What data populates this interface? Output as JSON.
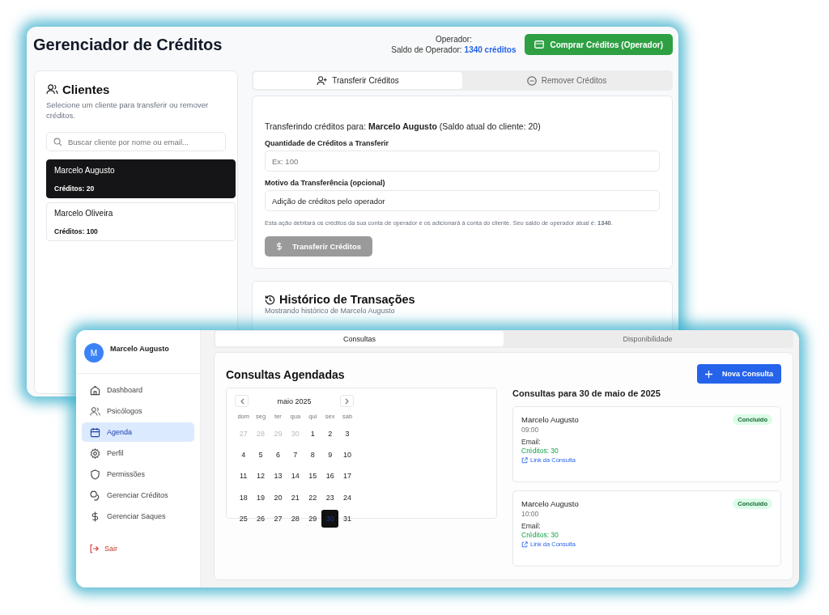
{
  "credit_window": {
    "title": "Gerenciador de Créditos",
    "operator_label": "Operador:",
    "balance_label": "Saldo de Operador:",
    "balance_value": "1340 créditos",
    "buy_button": "Comprar Créditos (Operador)",
    "clients": {
      "title": "Clientes",
      "subtitle": "Selecione um cliente para transferir ou remover créditos.",
      "search_placeholder": "Buscar cliente por nome ou email...",
      "items": [
        {
          "name": "Marcelo Augusto",
          "credits": "Créditos: 20",
          "selected": true
        },
        {
          "name": "Marcelo Oliveira",
          "credits": "Créditos: 100",
          "selected": false
        }
      ]
    },
    "tabs": [
      {
        "label": "Transferir Créditos",
        "selected": true
      },
      {
        "label": "Remover Créditos",
        "selected": false
      }
    ],
    "transfer": {
      "heading": "Transferindo créditos para: **Marcelo Augusto** (Saldo atual do cliente: 20)",
      "fields": [
        {
          "label": "Quantidade de Créditos a Transferir",
          "placeholder": "Ex: 100"
        },
        {
          "label": "Motivo da Transferência (opcional)",
          "value": "Adição de créditos pelo operador"
        }
      ],
      "note": "Esta ação debitará os créditos da sua conta de operador e os adicionará à conta do cliente. Seu saldo de operador atual é: **1340**.",
      "submit": {
        "label": "Transferir Créditos",
        "disabled": true
      }
    },
    "history": {
      "title": "Histórico de Transações",
      "subtitle": "Mostrando histórico de Marcelo Augusto"
    }
  },
  "agenda_window": {
    "user": {
      "initial": "M",
      "name": "Marcelo Augusto"
    },
    "nav": [
      {
        "label": "Dashboard",
        "selected": false
      },
      {
        "label": "Psicólogos",
        "selected": false
      },
      {
        "label": "Agenda",
        "selected": true
      },
      {
        "label": "Perfil",
        "selected": false
      },
      {
        "label": "Permissões",
        "selected": false
      },
      {
        "label": "Gerenciar Créditos",
        "selected": false
      },
      {
        "label": "Gerenciar Saques",
        "selected": false
      }
    ],
    "logout": "Sair",
    "tabs": [
      {
        "label": "Consultas",
        "selected": true
      },
      {
        "label": "Disponibilidade",
        "selected": false
      }
    ],
    "title": "Consultas Agendadas",
    "calendar": {
      "month": "maio 2025",
      "weekdays": [
        "dom",
        "seg",
        "ter",
        "qua",
        "qui",
        "sex",
        "sab"
      ],
      "weeks": [
        [
          {
            "day": "27",
            "muted": true,
            "selected": false
          },
          {
            "day": "28",
            "muted": true,
            "selected": false
          },
          {
            "day": "29",
            "muted": true,
            "selected": false
          },
          {
            "day": "30",
            "muted": true,
            "selected": false
          },
          {
            "day": "1",
            "muted": false,
            "selected": false
          },
          {
            "day": "2",
            "muted": false,
            "selected": false
          },
          {
            "day": "3",
            "muted": false,
            "selected": false
          }
        ],
        [
          {
            "day": "4",
            "muted": false,
            "selected": false
          },
          {
            "day": "5",
            "muted": false,
            "selected": false
          },
          {
            "day": "6",
            "muted": false,
            "selected": false
          },
          {
            "day": "7",
            "muted": false,
            "selected": false
          },
          {
            "day": "8",
            "muted": false,
            "selected": false
          },
          {
            "day": "9",
            "muted": false,
            "selected": false
          },
          {
            "day": "10",
            "muted": false,
            "selected": false
          }
        ],
        [
          {
            "day": "11",
            "muted": false,
            "selected": false
          },
          {
            "day": "12",
            "muted": false,
            "selected": false
          },
          {
            "day": "13",
            "muted": false,
            "selected": false
          },
          {
            "day": "14",
            "muted": false,
            "selected": false
          },
          {
            "day": "15",
            "muted": false,
            "selected": false
          },
          {
            "day": "16",
            "muted": false,
            "selected": false
          },
          {
            "day": "17",
            "muted": false,
            "selected": false
          }
        ],
        [
          {
            "day": "18",
            "muted": false,
            "selected": false
          },
          {
            "day": "19",
            "muted": false,
            "selected": false
          },
          {
            "day": "20",
            "muted": false,
            "selected": false
          },
          {
            "day": "21",
            "muted": false,
            "selected": false
          },
          {
            "day": "22",
            "muted": false,
            "selected": false
          },
          {
            "day": "23",
            "muted": false,
            "selected": false
          },
          {
            "day": "24",
            "muted": false,
            "selected": false
          }
        ],
        [
          {
            "day": "25",
            "muted": false,
            "selected": false
          },
          {
            "day": "26",
            "muted": false,
            "selected": false
          },
          {
            "day": "27",
            "muted": false,
            "selected": false
          },
          {
            "day": "28",
            "muted": false,
            "selected": false
          },
          {
            "day": "29",
            "muted": false,
            "selected": false
          },
          {
            "day": "30",
            "muted": false,
            "selected": true
          },
          {
            "day": "31",
            "muted": false,
            "selected": false
          }
        ]
      ]
    },
    "new_button": "Nova Consulta",
    "day_title": "Consultas para 30 de maio de 2025",
    "appointments": [
      {
        "name": "Marcelo Augusto",
        "time": "09:00",
        "email_label": "Email:",
        "credits": "Créditos: 30",
        "link": "Link da Consulta",
        "status": "Concluído"
      },
      {
        "name": "Marcelo Augusto",
        "time": "10:00",
        "email_label": "Email:",
        "credits": "Créditos: 30",
        "link": "Link da Consulta",
        "status": "Concluído"
      }
    ]
  }
}
